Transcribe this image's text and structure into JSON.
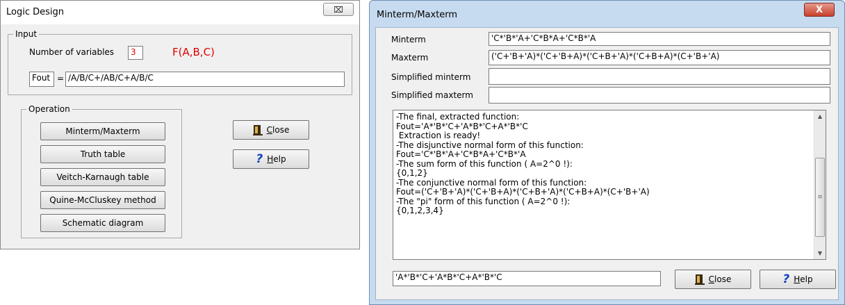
{
  "window1": {
    "title": "Logic Design",
    "close_button": "⌧",
    "input_group": {
      "legend": "Input",
      "num_vars_label": "Number of variables",
      "num_vars_value": "3",
      "function_label": "F(A,B,C)",
      "fout_label": "Fout",
      "equals": "=",
      "expression": "/A/B/C+/AB/C+A/B/C"
    },
    "operation_group": {
      "legend": "Operation",
      "buttons": [
        "Minterm/Maxterm",
        "Truth table",
        "Veitch-Karnaugh table",
        "Quine-McCluskey method",
        "Schematic diagram"
      ]
    },
    "close_label": "Close",
    "help_label": "Help"
  },
  "window2": {
    "title": "Minterm/Maxterm",
    "close_button": "X",
    "fields": [
      {
        "label": "Minterm",
        "value": "'C*'B*'A+'C*B*A+'C*B*'A"
      },
      {
        "label": "Maxterm",
        "value": "('C+'B+'A)*('C+'B+A)*('C+B+'A)*('C+B+A)*(C+'B+'A)"
      },
      {
        "label": "Simplified minterm",
        "value": ""
      },
      {
        "label": "Simplified maxterm",
        "value": ""
      }
    ],
    "log_lines": [
      "-The final, extracted function:",
      "Fout='A*'B*'C+'A*B*'C+A*'B*'C",
      " Extraction is ready!",
      "-The disjunctive normal form of this function:",
      "Fout='C*'B*'A+'C*B*A+'C*B*'A",
      "-The sum form of this function ( A=2^0 !):",
      "{0,1,2}",
      "-The conjunctive normal form of this function:",
      "Fout=('C+'B+'A)*('C+'B+A)*('C+B+'A)*('C+B+A)*(C+'B+'A)",
      "-The \"pi\" form of this function ( A=2^0 !):",
      "{0,1,2,3,4}"
    ],
    "bottom_value": "'A*'B*'C+'A*B*'C+A*'B*'C",
    "close_label": "Close",
    "help_label": "Help"
  },
  "colors": {
    "red_text": "#e00000",
    "help_icon": "#1040c0",
    "close_icon": "#3a2a10"
  }
}
